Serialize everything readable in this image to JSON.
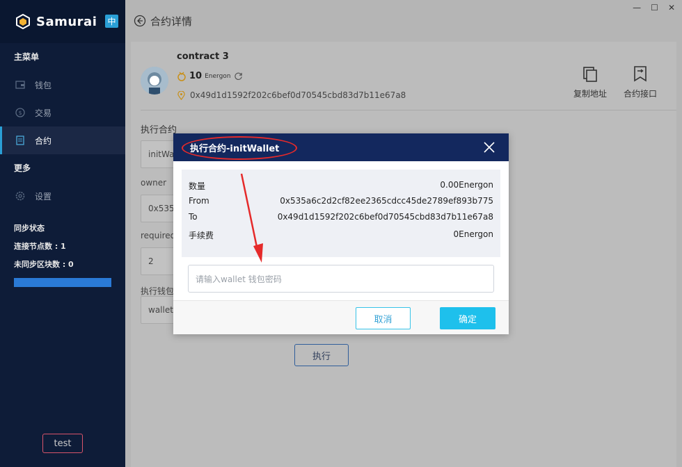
{
  "app": {
    "name": "Samurai",
    "lang_badge": "中"
  },
  "sidebar": {
    "main_menu_title": "主菜单",
    "items": [
      {
        "label": "钱包",
        "icon": "wallet-icon"
      },
      {
        "label": "交易",
        "icon": "exchange-icon"
      },
      {
        "label": "合约",
        "icon": "contract-icon",
        "active": true
      }
    ],
    "more_title": "更多",
    "settings_label": "设置",
    "sync_title": "同步状态",
    "nodes_label": "连接节点数 : 1",
    "unsynced_label": "未同步区块数 : 0",
    "user_button": "test"
  },
  "header": {
    "title": "合约详情"
  },
  "contract": {
    "name": "contract 3",
    "balance": "10",
    "unit": "Energon",
    "address": "0x49d1d1592f202c6bef0d70545cbd83d7b11e67a8",
    "copy_label": "复制地址",
    "interface_label": "合约接口"
  },
  "form": {
    "title": "执行合约",
    "field1_value": "initWal",
    "owner_label": "owner",
    "owner_value": "0x535a",
    "required_label": "required",
    "required_value": "2",
    "wallet_label": "执行钱包",
    "wallet_value": "wallet",
    "exec_button": "执行"
  },
  "dialog": {
    "title": "执行合约-initWallet",
    "rows": [
      {
        "label": "数量",
        "value": "0.00Energon"
      },
      {
        "label": "From",
        "value": "0x535a6c2d2cf82ee2365cdcc45de2789ef893b775"
      },
      {
        "label": "To",
        "value": "0x49d1d1592f202c6bef0d70545cbd83d7b11e67a8"
      },
      {
        "label": "手续费",
        "value": "0Energon"
      }
    ],
    "password_placeholder": "请输入wallet 钱包密码",
    "cancel_label": "取消",
    "ok_label": "确定"
  },
  "colors": {
    "sidebar_bg": "#0e1c38",
    "dialog_header": "#13285e",
    "accent": "#1ec0ec",
    "annotation": "#e52a2a"
  }
}
